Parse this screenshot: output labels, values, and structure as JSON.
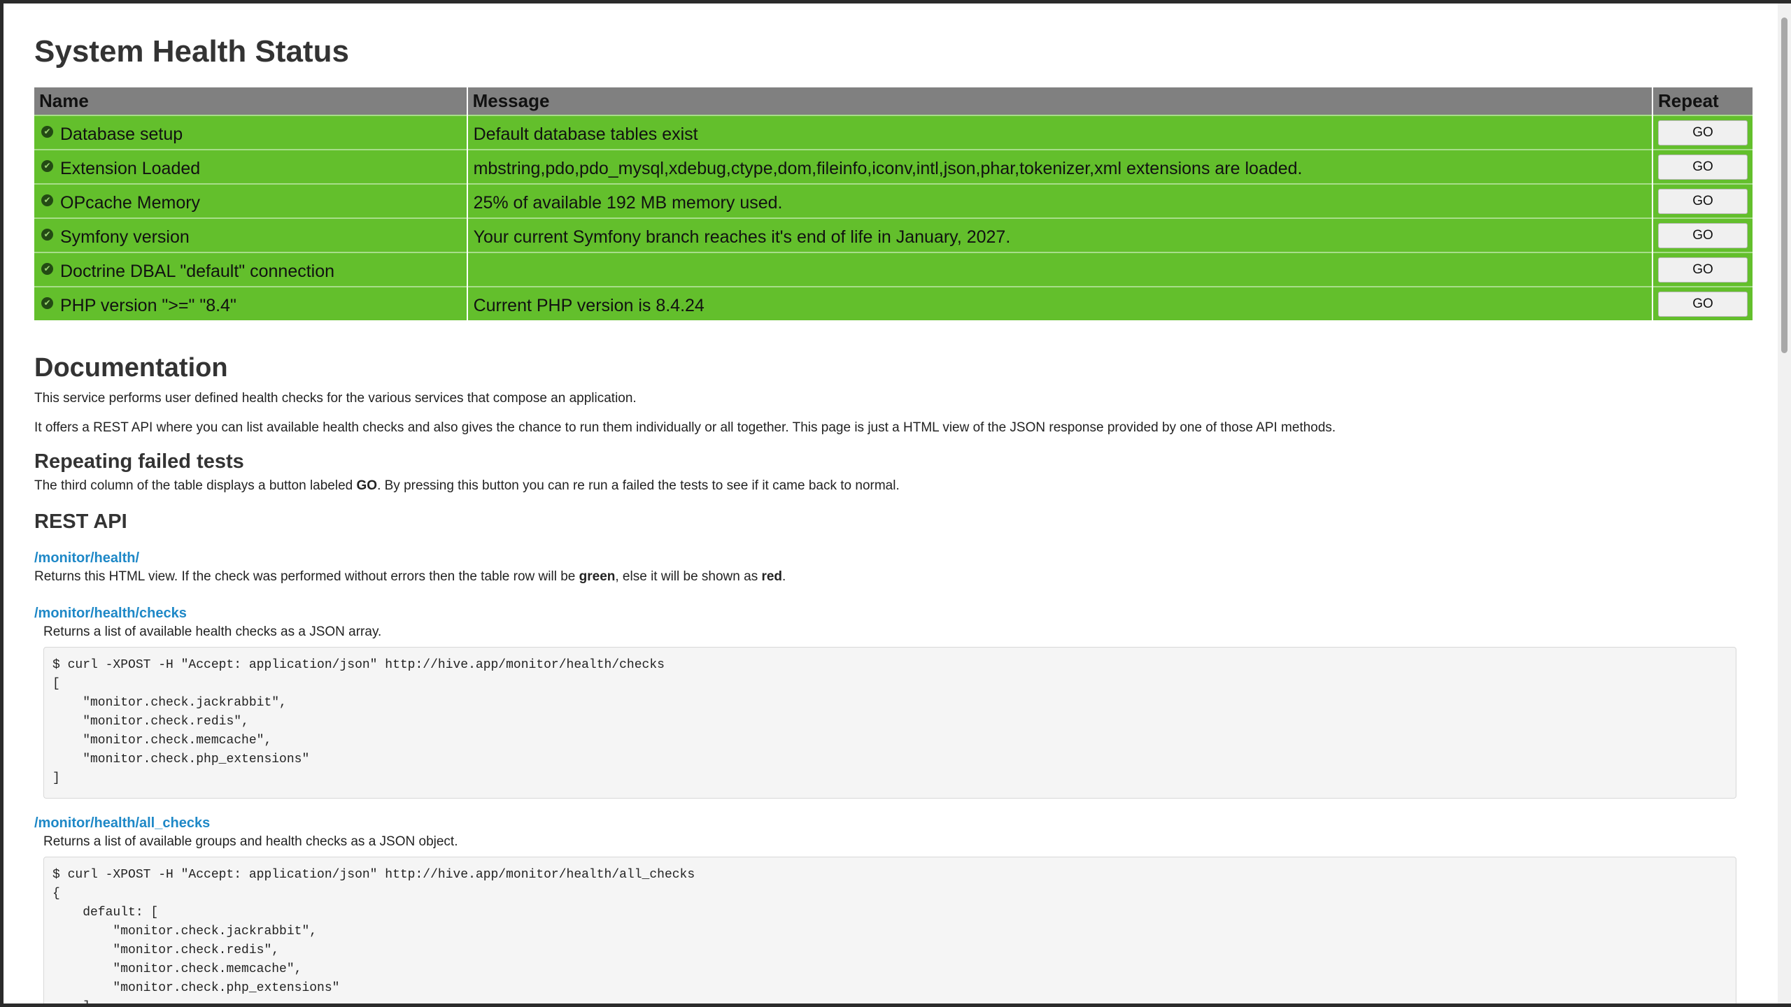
{
  "page": {
    "title": "System Health Status",
    "table": {
      "headers": {
        "name": "Name",
        "message": "Message",
        "repeat": "Repeat"
      },
      "go_label": "GO",
      "rows": [
        {
          "name": "Database setup",
          "message": "Default database tables exist"
        },
        {
          "name": "Extension Loaded",
          "message": "mbstring,pdo,pdo_mysql,xdebug,ctype,dom,fileinfo,iconv,intl,json,phar,tokenizer,xml extensions are loaded."
        },
        {
          "name": "OPcache Memory",
          "message": "25% of available 192 MB memory used."
        },
        {
          "name": "Symfony version",
          "message": "Your current Symfony branch reaches it's end of life in January, 2027."
        },
        {
          "name": "Doctrine DBAL \"default\" connection",
          "message": ""
        },
        {
          "name": "PHP version \">=\" \"8.4\"",
          "message": "Current PHP version is 8.4.24"
        }
      ],
      "row_status_color": "#63bf2c"
    },
    "docs": {
      "heading": "Documentation",
      "intro1": "This service performs user defined health checks for the various services that compose an application.",
      "intro2": "It offers a REST API where you can list available health checks and also gives the chance to run them individually or all together. This page is just a HTML view of the JSON response provided by one of those API methods.",
      "repeat_heading": "Repeating failed tests",
      "repeat_text_pre": "The third column of the table displays a button labeled ",
      "repeat_text_bold": "GO",
      "repeat_text_post": ". By pressing this button you can re run a failed the tests to see if it came back to normal.",
      "api_heading": "REST API",
      "endpoints": [
        {
          "path": "/monitor/health/",
          "desc_pre": "Returns this HTML view. If the check was performed without errors then the table row will be ",
          "desc_green": "green",
          "desc_mid": ", else it will be shown as ",
          "desc_red": "red",
          "desc_post": "."
        },
        {
          "path": "/monitor/health/checks",
          "desc": "Returns a list of available health checks as a JSON array.",
          "code": "$ curl -XPOST -H \"Accept: application/json\" http://hive.app/monitor/health/checks\n[\n    \"monitor.check.jackrabbit\",\n    \"monitor.check.redis\",\n    \"monitor.check.memcache\",\n    \"monitor.check.php_extensions\"\n]"
        },
        {
          "path": "/monitor/health/all_checks",
          "desc": "Returns a list of available groups and health checks as a JSON object.",
          "code": "$ curl -XPOST -H \"Accept: application/json\" http://hive.app/monitor/health/all_checks\n{\n    default: [\n        \"monitor.check.jackrabbit\",\n        \"monitor.check.redis\",\n        \"monitor.check.memcache\",\n        \"monitor.check.php_extensions\"\n    ],"
        }
      ]
    }
  }
}
